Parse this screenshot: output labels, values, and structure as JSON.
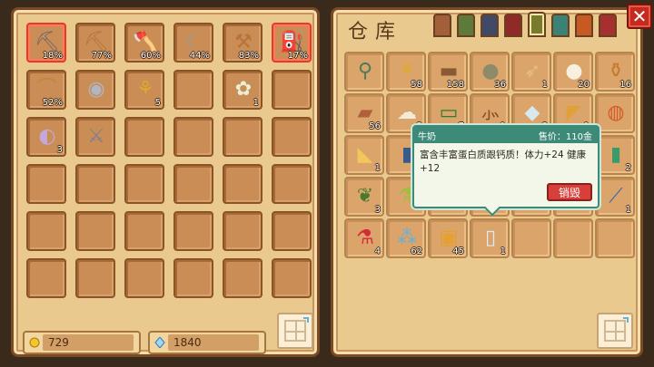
{
  "inventory": {
    "slots": [
      {
        "icon": "pickaxe-icon",
        "glyph": "⛏",
        "qty": "18%",
        "color": "#6b6b6b",
        "selected": true
      },
      {
        "icon": "copper-pickaxe-icon",
        "glyph": "⛏",
        "qty": "77%",
        "color": "#b8733a"
      },
      {
        "icon": "axe-icon",
        "glyph": "🪓",
        "qty": "60%",
        "color": "#b34a3a"
      },
      {
        "icon": "scythe-icon",
        "glyph": "☾",
        "qty": "44%",
        "color": "#9a9a9a"
      },
      {
        "icon": "hoe-icon",
        "glyph": "⚒",
        "qty": "83%",
        "color": "#b8733a"
      },
      {
        "icon": "watering-can-icon",
        "glyph": "⛽",
        "qty": "17%",
        "color": "#9aa4ac",
        "selected": true
      },
      {
        "icon": "fishing-rod-icon",
        "glyph": "⌒",
        "qty": "52%",
        "color": "#c4843c"
      },
      {
        "icon": "milk-bottle-icon",
        "glyph": "◉",
        "qty": "",
        "color": "#aeb8c4"
      },
      {
        "icon": "wheat-icon",
        "glyph": "⚘",
        "qty": "5",
        "color": "#e0a82e"
      },
      {
        "icon": "",
        "glyph": "",
        "qty": ""
      },
      {
        "icon": "flower-bouquet-icon",
        "glyph": "✿",
        "qty": "1",
        "color": "#eaeed6"
      },
      {
        "icon": "",
        "glyph": "",
        "qty": ""
      },
      {
        "icon": "shell-icon",
        "glyph": "◐",
        "qty": "3",
        "color": "#c6a8d8"
      },
      {
        "icon": "sword-icon",
        "glyph": "⚔",
        "qty": "",
        "color": "#7d8090"
      }
    ],
    "gold": "729",
    "gems": "1840"
  },
  "store": {
    "title": "仓库",
    "tabs": [
      {
        "name": "tab-brown",
        "color": "#a35f3a"
      },
      {
        "name": "tab-green",
        "color": "#5e7a3a"
      },
      {
        "name": "tab-navy",
        "color": "#3e4a68"
      },
      {
        "name": "tab-dark-red",
        "color": "#8f2a28"
      },
      {
        "name": "tab-olive",
        "color": "#7a7a2e",
        "active": true
      },
      {
        "name": "tab-teal",
        "color": "#3a8276"
      },
      {
        "name": "tab-orange",
        "color": "#c65a22"
      },
      {
        "name": "tab-red",
        "color": "#a63030"
      }
    ],
    "items": [
      {
        "icon": "shovel-icon",
        "glyph": "⚲",
        "qty": "",
        "color": "#4e7a58"
      },
      {
        "icon": "wheat-bundle-icon",
        "glyph": "⚘",
        "qty": "58",
        "color": "#e0a82e"
      },
      {
        "icon": "wood-log-icon",
        "glyph": "▬",
        "qty": "158",
        "color": "#8a5a34"
      },
      {
        "icon": "stone-icon",
        "glyph": "●",
        "qty": "36",
        "color": "#8e8a6a"
      },
      {
        "icon": "parsnip-icon",
        "glyph": "➶",
        "qty": "1",
        "color": "#e6c07a"
      },
      {
        "icon": "egg-icon",
        "glyph": "●",
        "qty": "20",
        "color": "#f7efe0"
      },
      {
        "icon": "bottle-icon",
        "glyph": "⚱",
        "qty": "16",
        "color": "#c77a2a"
      },
      {
        "icon": "plank-icon",
        "glyph": "▰",
        "qty": "56",
        "color": "#b0603a"
      },
      {
        "icon": "wool-icon",
        "glyph": "☁",
        "qty": "2",
        "color": "#f2ebd6"
      },
      {
        "icon": "seed-pack-icon",
        "glyph": "▭",
        "qty": "7",
        "color": "#2f7a38"
      },
      {
        "icon": "branch-icon",
        "glyph": "⺗",
        "qty": "1",
        "color": "#8a4a24"
      },
      {
        "icon": "diamond-icon",
        "glyph": "◆",
        "qty": "3",
        "color": "#d8e8f0"
      },
      {
        "icon": "pizza-icon",
        "glyph": "◤",
        "qty": "1",
        "color": "#e0a03a"
      },
      {
        "icon": "soup-bowl-icon",
        "glyph": "◍",
        "qty": "",
        "color": "#d65a2a"
      },
      {
        "icon": "cheese-icon",
        "glyph": "◣",
        "qty": "1",
        "color": "#f0c85a"
      },
      {
        "icon": "can-icon",
        "glyph": "▮",
        "qty": "",
        "color": "#3a5a8a"
      },
      {
        "icon": "",
        "glyph": "",
        "qty": ""
      },
      {
        "icon": "",
        "glyph": "",
        "qty": ""
      },
      {
        "icon": "",
        "glyph": "",
        "qty": ""
      },
      {
        "icon": "",
        "glyph": "",
        "qty": ""
      },
      {
        "icon": "potion-jar-icon",
        "glyph": "▮",
        "qty": "2",
        "color": "#3a9a6a"
      },
      {
        "icon": "herb-sack-icon",
        "glyph": "❦",
        "qty": "3",
        "color": "#4a7a2e"
      },
      {
        "icon": "green-potion-icon",
        "glyph": "⚗",
        "qty": "",
        "color": "#9ac23a"
      },
      {
        "icon": "",
        "glyph": "",
        "qty": ""
      },
      {
        "icon": "",
        "glyph": "",
        "qty": ""
      },
      {
        "icon": "",
        "glyph": "",
        "qty": ""
      },
      {
        "icon": "",
        "glyph": "",
        "qty": ""
      },
      {
        "icon": "wand-icon",
        "glyph": "⟋",
        "qty": "1",
        "color": "#3a6ab0"
      },
      {
        "icon": "red-potion-icon",
        "glyph": "⚗",
        "qty": "4",
        "color": "#d62a3a"
      },
      {
        "icon": "confetti-icon",
        "glyph": "⁂",
        "qty": "62",
        "color": "#6ab0d6"
      },
      {
        "icon": "honey-jar-icon",
        "glyph": "▣",
        "qty": "45",
        "color": "#e6a030"
      },
      {
        "icon": "milk-icon",
        "glyph": "▯",
        "qty": "1",
        "color": "#dfeaf2",
        "selected": true
      },
      {
        "icon": "",
        "glyph": "",
        "qty": ""
      },
      {
        "icon": "",
        "glyph": "",
        "qty": ""
      },
      {
        "icon": "",
        "glyph": "",
        "qty": ""
      }
    ]
  },
  "tooltip": {
    "name": "牛奶",
    "price": "售价：110金",
    "description": "富含丰富蛋白质跟钙质！体力+24 健康+12",
    "destroy_label": "销毁"
  },
  "close_label": "✕",
  "colors": {
    "gold": "#f2c62a",
    "gem": "#9fd6f2"
  }
}
